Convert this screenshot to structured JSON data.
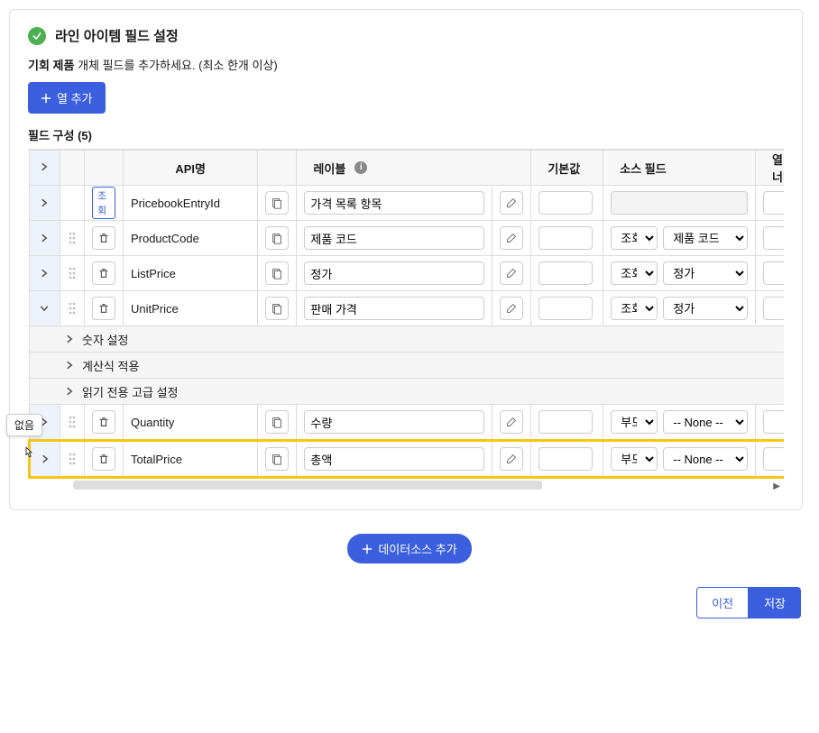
{
  "panel": {
    "title": "라인 아이템 필드 설정",
    "subtitle_bold": "기회 제품",
    "subtitle_rest": " 개체 필드를 추가하세요. (최소 한개 이상)",
    "add_column_label": "열 추가",
    "section_label": "필드 구성 (5)"
  },
  "headers": {
    "api": "API명",
    "label": "레이블",
    "default": "기본값",
    "source": "소스 필드",
    "width": "열 너비"
  },
  "rows": [
    {
      "lookup": "조회",
      "api": "PricebookEntryId",
      "label": "가격 목록 항목",
      "src_mode": "",
      "src_field": "",
      "def": "",
      "w": "",
      "deletable": false
    },
    {
      "lookup": "",
      "api": "ProductCode",
      "label": "제품 코드",
      "src_mode": "조회",
      "src_field": "제품 코드",
      "def": "",
      "w": "",
      "deletable": true
    },
    {
      "lookup": "",
      "api": "ListPrice",
      "label": "정가",
      "src_mode": "조회",
      "src_field": "정가",
      "def": "",
      "w": "",
      "deletable": true
    },
    {
      "lookup": "",
      "api": "UnitPrice",
      "label": "판매 가격",
      "src_mode": "조회",
      "src_field": "정가",
      "def": "",
      "w": "",
      "deletable": true,
      "expanded": true
    },
    {
      "lookup": "",
      "api": "Quantity",
      "label": "수량",
      "src_mode": "부모",
      "src_field": "-- None --",
      "def": "",
      "w": "",
      "deletable": true
    },
    {
      "lookup": "",
      "api": "TotalPrice",
      "label": "총액",
      "src_mode": "부모",
      "src_field": "-- None --",
      "def": "",
      "w": "",
      "deletable": true,
      "highlight": true
    }
  ],
  "sub_rows": [
    "숫자 설정",
    "계산식 적용",
    "읽기 전용 고급 설정"
  ],
  "tooltip": "없음",
  "add_datasource_label": "데이터소스 추가",
  "footer": {
    "prev": "이전",
    "save": "저장"
  }
}
